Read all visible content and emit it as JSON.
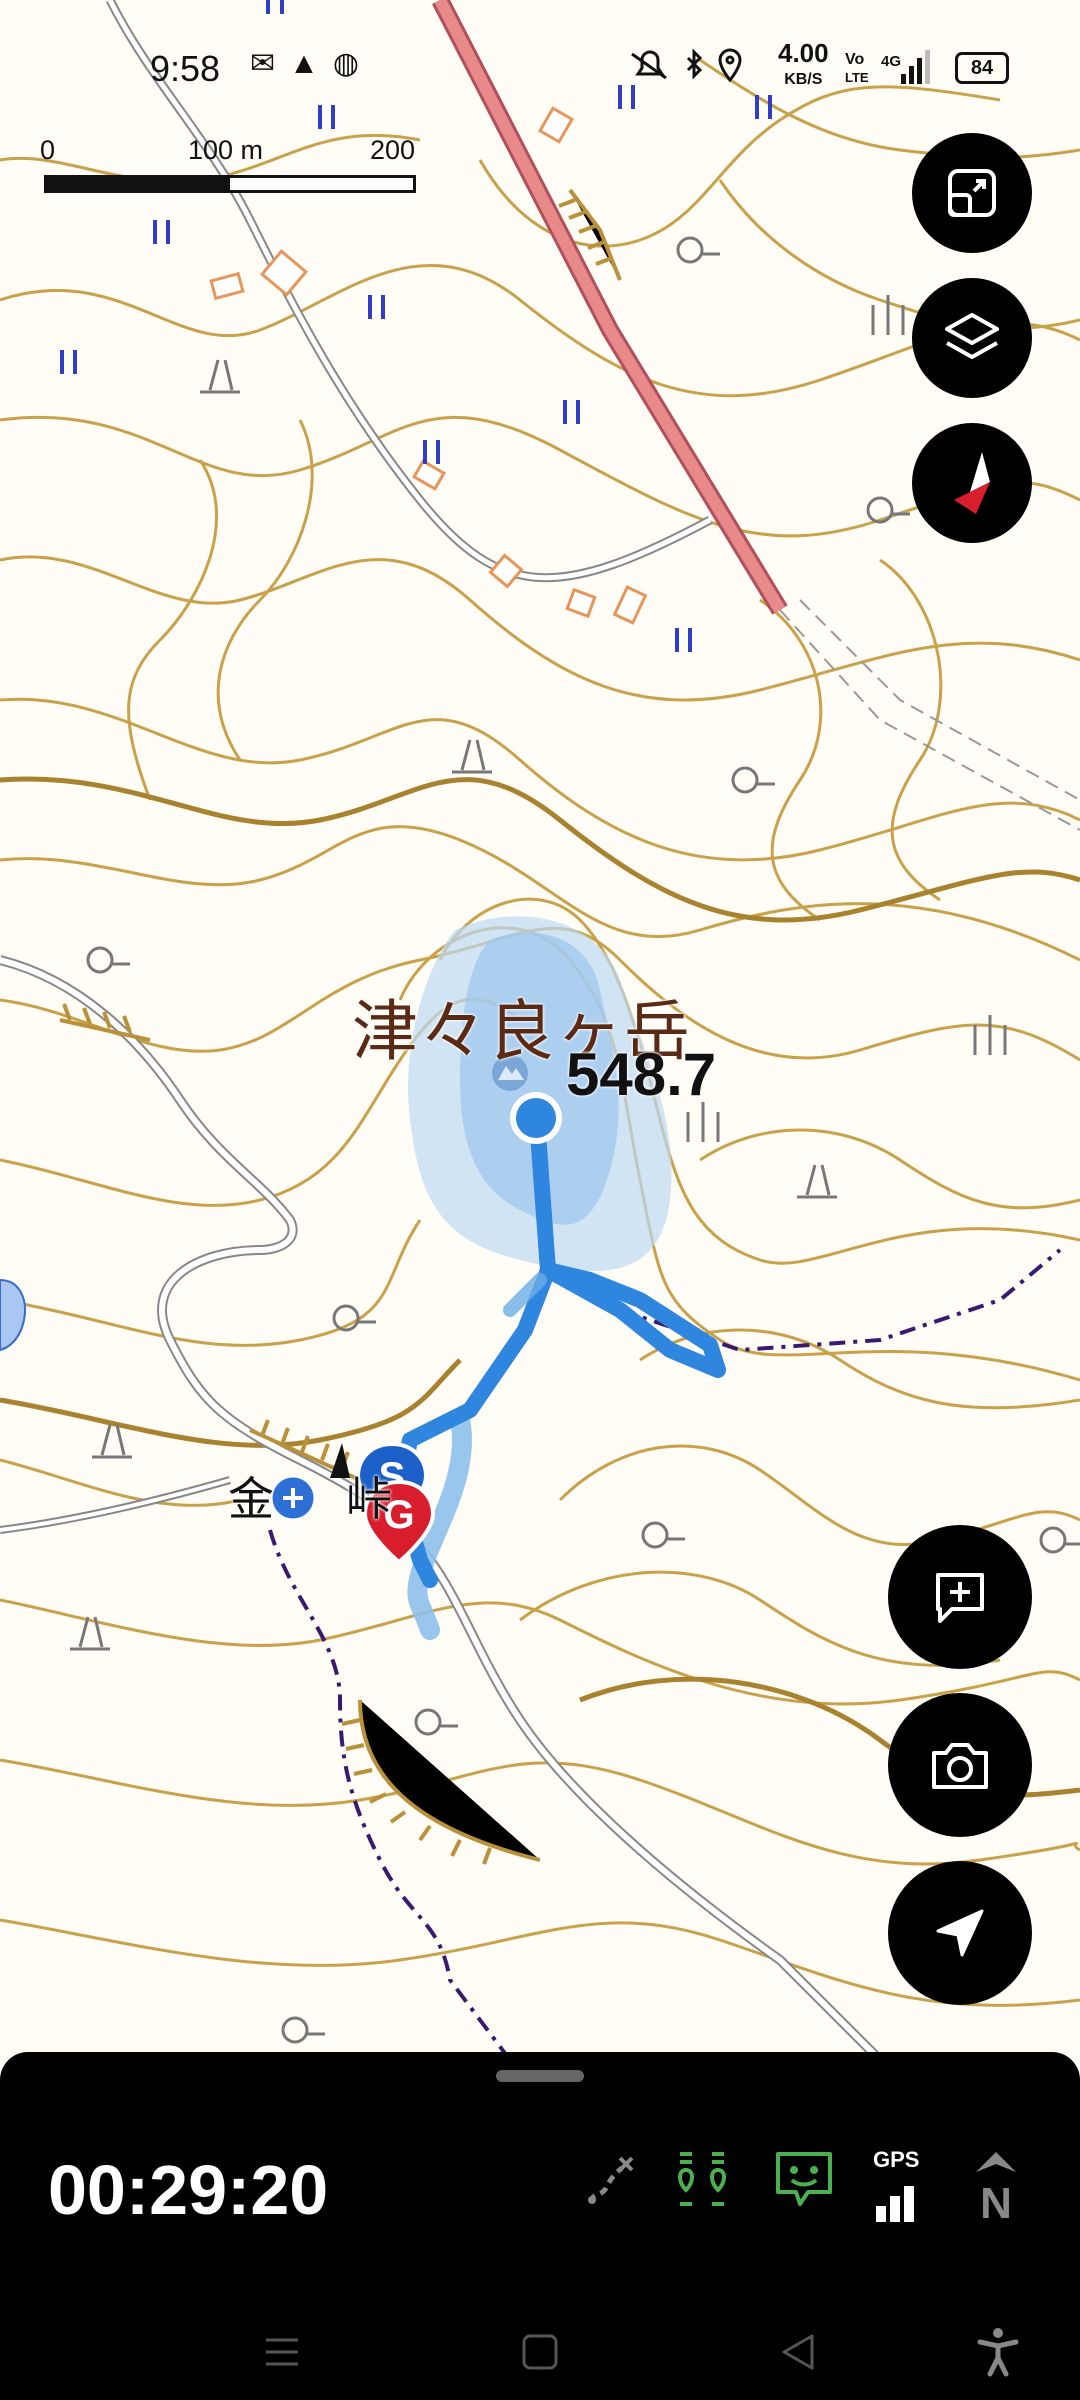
{
  "status_bar": {
    "time": "9:58",
    "left_icons": [
      "mail-icon",
      "triangle-icon",
      "globe-icon"
    ],
    "right_icons": [
      "mute-icon",
      "bluetooth-icon",
      "location-icon",
      "volte-icon",
      "4g-signal-icon"
    ],
    "net_speed_value": "4.00",
    "net_speed_unit": "KB/S",
    "battery": "84"
  },
  "scale_bar": {
    "label_0": "0",
    "label_mid": "100 m",
    "label_max": "200 m"
  },
  "map": {
    "peak_name": "津々良ヶ岳",
    "peak_elevation": "548.7",
    "place_name": "金",
    "place_name_tail": "峠",
    "marker_start": "S",
    "marker_goal": "G",
    "route_color": "#2e86de",
    "contour_color": "#b8913a",
    "trail_color": "#3a1a6e",
    "road_color": "#e57373"
  },
  "buttons": {
    "fullscreen": "fullscreen-icon",
    "layers": "layers-icon",
    "compass": "compass-icon",
    "add_memo": "add-memo-icon",
    "camera": "camera-icon",
    "locate": "locate-icon"
  },
  "bottom_panel": {
    "elapsed_time": "00:29:20",
    "gps_label": "GPS",
    "north_label": "N"
  }
}
